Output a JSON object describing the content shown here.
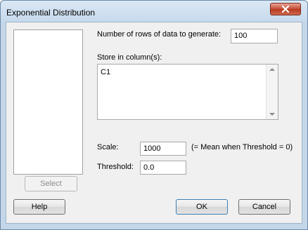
{
  "window": {
    "title": "Exponential Distribution",
    "close_icon": "close-icon"
  },
  "form": {
    "rows_label": "Number of rows of data to generate:",
    "rows_value": "100",
    "store_label": "Store in column(s):",
    "store_value": "C1",
    "scale_label": "Scale:",
    "scale_value": "1000",
    "scale_hint": "(= Mean when Threshold = 0)",
    "threshold_label": "Threshold:",
    "threshold_value": "0.0"
  },
  "buttons": {
    "select": "Select",
    "help": "Help",
    "ok": "OK",
    "cancel": "Cancel"
  }
}
